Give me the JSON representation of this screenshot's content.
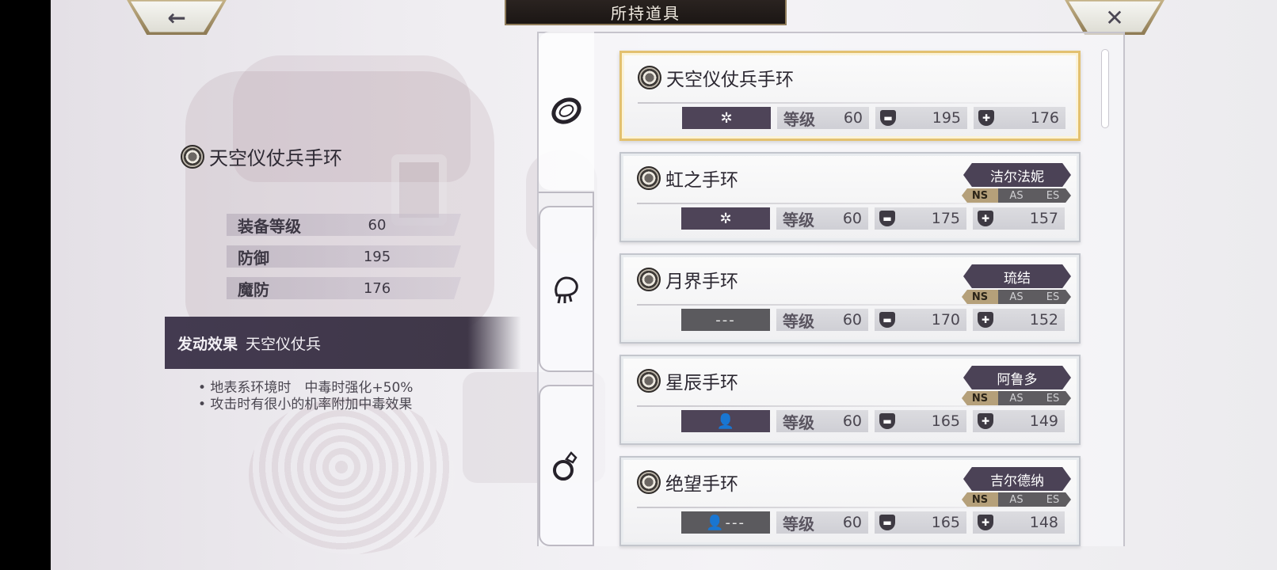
{
  "header": {
    "title": "所持道具",
    "back_icon": "←",
    "close_icon": "✕"
  },
  "detail": {
    "item_name": "天空仪仗兵手环",
    "stats": [
      {
        "label": "装备等级",
        "value": "60"
      },
      {
        "label": "防御",
        "value": "195"
      },
      {
        "label": "魔防",
        "value": "176"
      }
    ],
    "effect_label": "发动效果",
    "effect_name": "天空仪仗兵",
    "effect_lines": [
      "• 地表系环境时　中毒时强化+50%",
      "• 攻击时有很小的机率附加中毒效果"
    ]
  },
  "tabs": [
    {
      "name": "bracelet",
      "icon": "bracelet-icon"
    },
    {
      "name": "hand",
      "icon": "hand-icon"
    },
    {
      "name": "ring",
      "icon": "ring-icon"
    }
  ],
  "level_label": "等级",
  "items": [
    {
      "name": "天空仪仗兵手环",
      "attr": "✲",
      "level": "60",
      "def": "195",
      "mdef": "176",
      "owner": "",
      "selected": true
    },
    {
      "name": "虹之手环",
      "attr": "✲",
      "level": "60",
      "def": "175",
      "mdef": "157",
      "owner": "洁尔法妮",
      "tags": [
        "NS",
        "AS",
        "ES"
      ]
    },
    {
      "name": "月界手环",
      "attr": "---",
      "level": "60",
      "def": "170",
      "mdef": "152",
      "owner": "琉结",
      "tags": [
        "NS",
        "AS",
        "ES"
      ]
    },
    {
      "name": "星辰手环",
      "attr": "👤",
      "level": "60",
      "def": "165",
      "mdef": "149",
      "owner": "阿鲁多",
      "tags": [
        "NS",
        "AS",
        "ES"
      ]
    },
    {
      "name": "绝望手环",
      "attr": "👤---",
      "level": "60",
      "def": "165",
      "mdef": "148",
      "owner": "吉尔德纳",
      "tags": [
        "NS",
        "AS",
        "ES"
      ]
    }
  ],
  "colors": {
    "accent": "#e3c170",
    "panel": "#433a50"
  }
}
